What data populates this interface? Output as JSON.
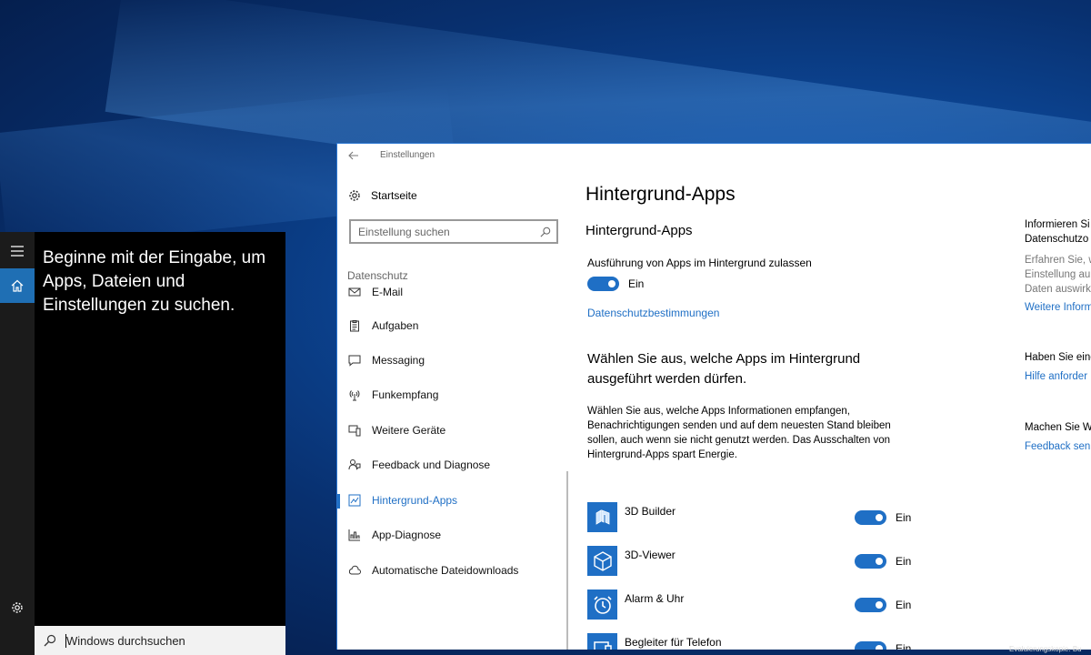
{
  "cortana": {
    "prompt": "Beginne mit der Eingabe, um Apps, Dateien und Einstellungen zu suchen.",
    "search_placeholder": "Windows durchsuchen"
  },
  "window": {
    "title": "Einstellungen"
  },
  "nav": {
    "home_label": "Startseite",
    "search_placeholder": "Einstellung suchen",
    "section": "Datenschutz",
    "items": [
      {
        "label": "E-Mail",
        "icon": "mail-icon"
      },
      {
        "label": "Aufgaben",
        "icon": "clipboard-icon"
      },
      {
        "label": "Messaging",
        "icon": "message-icon"
      },
      {
        "label": "Funkempfang",
        "icon": "antenna-icon"
      },
      {
        "label": "Weitere Geräte",
        "icon": "devices-icon"
      },
      {
        "label": "Feedback und Diagnose",
        "icon": "feedback-icon"
      },
      {
        "label": "Hintergrund-Apps",
        "icon": "background-apps-icon",
        "active": true
      },
      {
        "label": "App-Diagnose",
        "icon": "diagnose-icon"
      },
      {
        "label": "Automatische Dateidownloads",
        "icon": "cloud-icon"
      }
    ]
  },
  "content": {
    "page_title": "Hintergrund-Apps",
    "section_title": "Hintergrund-Apps",
    "allow_label": "Ausführung von Apps im Hintergrund zulassen",
    "allow_state": "Ein",
    "privacy_link": "Datenschutzbestimmungen",
    "choose_heading": "Wählen Sie aus, welche Apps im Hintergrund ausgeführt werden dürfen.",
    "description": "Wählen Sie aus, welche Apps Informationen empfangen, Benachrichtigungen senden und auf dem neuesten Stand bleiben sollen, auch wenn sie nicht genutzt werden. Das Ausschalten von Hintergrund-Apps spart Energie.",
    "apps": [
      {
        "name": "3D Builder",
        "state": "Ein",
        "icon": "3d-builder-icon"
      },
      {
        "name": "3D-Viewer",
        "state": "Ein",
        "icon": "3d-viewer-icon"
      },
      {
        "name": "Alarm & Uhr",
        "state": "Ein",
        "icon": "alarm-clock-icon"
      },
      {
        "name": "Begleiter für Telefon",
        "state": "Ein",
        "icon": "phone-companion-icon"
      }
    ]
  },
  "side": {
    "info_heading_1": "Informieren Si",
    "info_heading_2": "Datenschutzo",
    "info_text_1": "Erfahren Sie, w",
    "info_text_2": "Einstellung au",
    "info_text_3": "Daten auswirk",
    "info_link": "Weitere Inform",
    "question_heading": "Haben Sie eine",
    "help_link": "Hilfe anforder",
    "improve_heading": "Machen Sie W",
    "feedback_link": "Feedback sen"
  },
  "watermark": "Evaluierungskopie. Bu",
  "colors": {
    "accent": "#1f6fc5",
    "cortana_bg": "#000000",
    "rail_bg": "#1b1b1b"
  }
}
